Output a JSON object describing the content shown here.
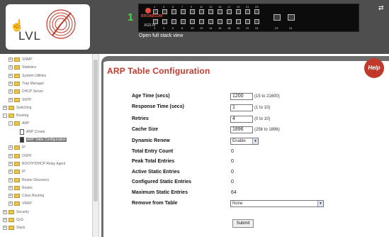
{
  "banner": {
    "logo_text": "LVL",
    "unit_number": "1",
    "brand": "BROADCOM",
    "model": "XGS III",
    "stack_link": "Open full stack view",
    "ports_top": [
      "1",
      "3",
      "5",
      "7",
      "9",
      "11",
      "13",
      "15",
      "17",
      "19",
      "21",
      "23"
    ],
    "ports_bottom": [
      "2",
      "4",
      "6",
      "8",
      "10",
      "12",
      "14",
      "16",
      "18",
      "20",
      "22",
      "24"
    ],
    "uplinks": [
      "23",
      "24"
    ]
  },
  "sidebar": {
    "items": [
      {
        "label": "SNMP",
        "indent": 1,
        "type": "folder",
        "expander": "+"
      },
      {
        "label": "Statistics",
        "indent": 1,
        "type": "folder",
        "expander": "+"
      },
      {
        "label": "System Utilities",
        "indent": 1,
        "type": "folder",
        "expander": "+"
      },
      {
        "label": "Trap Manager",
        "indent": 1,
        "type": "folder",
        "expander": "+"
      },
      {
        "label": "DHCP Server",
        "indent": 1,
        "type": "folder",
        "expander": "+"
      },
      {
        "label": "SNTP",
        "indent": 1,
        "type": "folder",
        "expander": "+"
      },
      {
        "label": "Switching",
        "indent": 0,
        "type": "folder",
        "expander": "+"
      },
      {
        "label": "Routing",
        "indent": 0,
        "type": "folder",
        "expander": "-"
      },
      {
        "label": "ARP",
        "indent": 1,
        "type": "folder",
        "expander": "-"
      },
      {
        "label": "ARP Create",
        "indent": 2,
        "type": "doc",
        "expander": ""
      },
      {
        "label": "ARP Table Configuration",
        "indent": 2,
        "type": "doc-selected",
        "expander": ""
      },
      {
        "label": "IP",
        "indent": 1,
        "type": "folder",
        "expander": "+"
      },
      {
        "label": "OSPF",
        "indent": 1,
        "type": "folder",
        "expander": "+"
      },
      {
        "label": "BOOTP/DHCP Relay Agent",
        "indent": 1,
        "type": "folder",
        "expander": "+"
      },
      {
        "label": "IP",
        "indent": 1,
        "type": "folder",
        "expander": "+"
      },
      {
        "label": "Router Discovery",
        "indent": 1,
        "type": "folder",
        "expander": "+"
      },
      {
        "label": "Router",
        "indent": 1,
        "type": "folder",
        "expander": "+"
      },
      {
        "label": "Class Routing",
        "indent": 1,
        "type": "folder",
        "expander": "+"
      },
      {
        "label": "VRRP",
        "indent": 1,
        "type": "folder",
        "expander": "+"
      },
      {
        "label": "Security",
        "indent": 0,
        "type": "folder",
        "expander": "+"
      },
      {
        "label": "QoS",
        "indent": 0,
        "type": "folder",
        "expander": "+"
      },
      {
        "label": "Stack",
        "indent": 0,
        "type": "folder",
        "expander": "+"
      }
    ]
  },
  "content": {
    "title": "ARP Table Configuration",
    "help_label": "Help",
    "fields": {
      "age_time_label": "Age Time (secs)",
      "age_time_value": "1200",
      "age_time_hint": "(15 to 21600)",
      "response_time_label": "Response Time (secs)",
      "response_time_value": "1",
      "response_time_hint": "(1 to 10)",
      "retries_label": "Retries",
      "retries_value": "4",
      "retries_hint": "(0 to 10)",
      "cache_size_label": "Cache Size",
      "cache_size_value": "1896",
      "cache_size_hint": "(256 to 1896)",
      "dynamic_renew_label": "Dynamic Renew",
      "dynamic_renew_value": "Enable",
      "total_entry_label": "Total Entry Count",
      "total_entry_value": "0",
      "peak_total_label": "Peak Total Entries",
      "peak_total_value": "0",
      "active_static_label": "Active Static Entries",
      "active_static_value": "0",
      "configured_static_label": "Configured Static Entries",
      "configured_static_value": "0",
      "max_static_label": "Maximum Static Entries",
      "max_static_value": "64",
      "remove_label": "Remove from Table",
      "remove_value": "None"
    },
    "submit_label": "Submit"
  },
  "colors": {
    "banner_bg": "#4e4e4e",
    "title_red": "#c0392b",
    "unit_green": "#3fdc3f"
  }
}
